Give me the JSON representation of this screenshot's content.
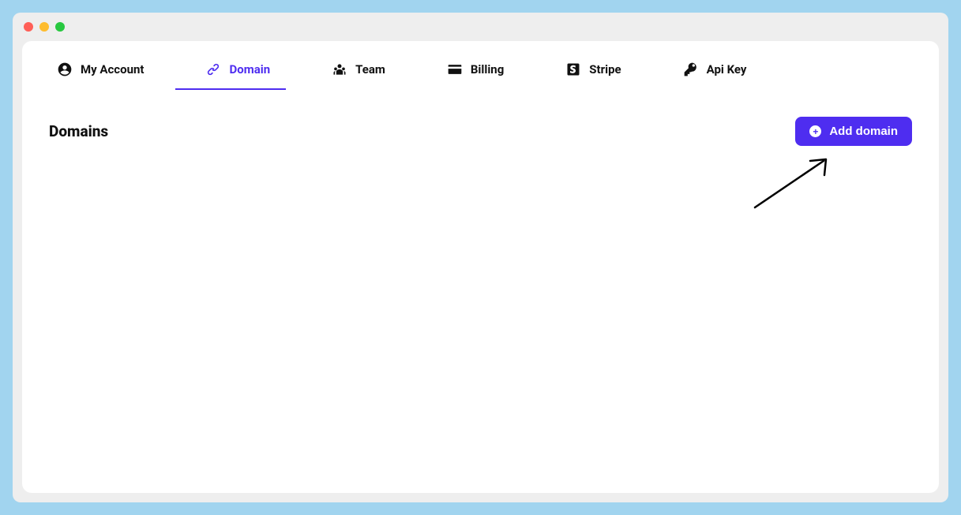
{
  "tabs": {
    "my_account": "My Account",
    "domain": "Domain",
    "team": "Team",
    "billing": "Billing",
    "stripe": "Stripe",
    "api_key": "Api Key"
  },
  "page": {
    "title": "Domains"
  },
  "buttons": {
    "add_domain": "Add domain"
  },
  "colors": {
    "accent": "#4e2df0"
  }
}
